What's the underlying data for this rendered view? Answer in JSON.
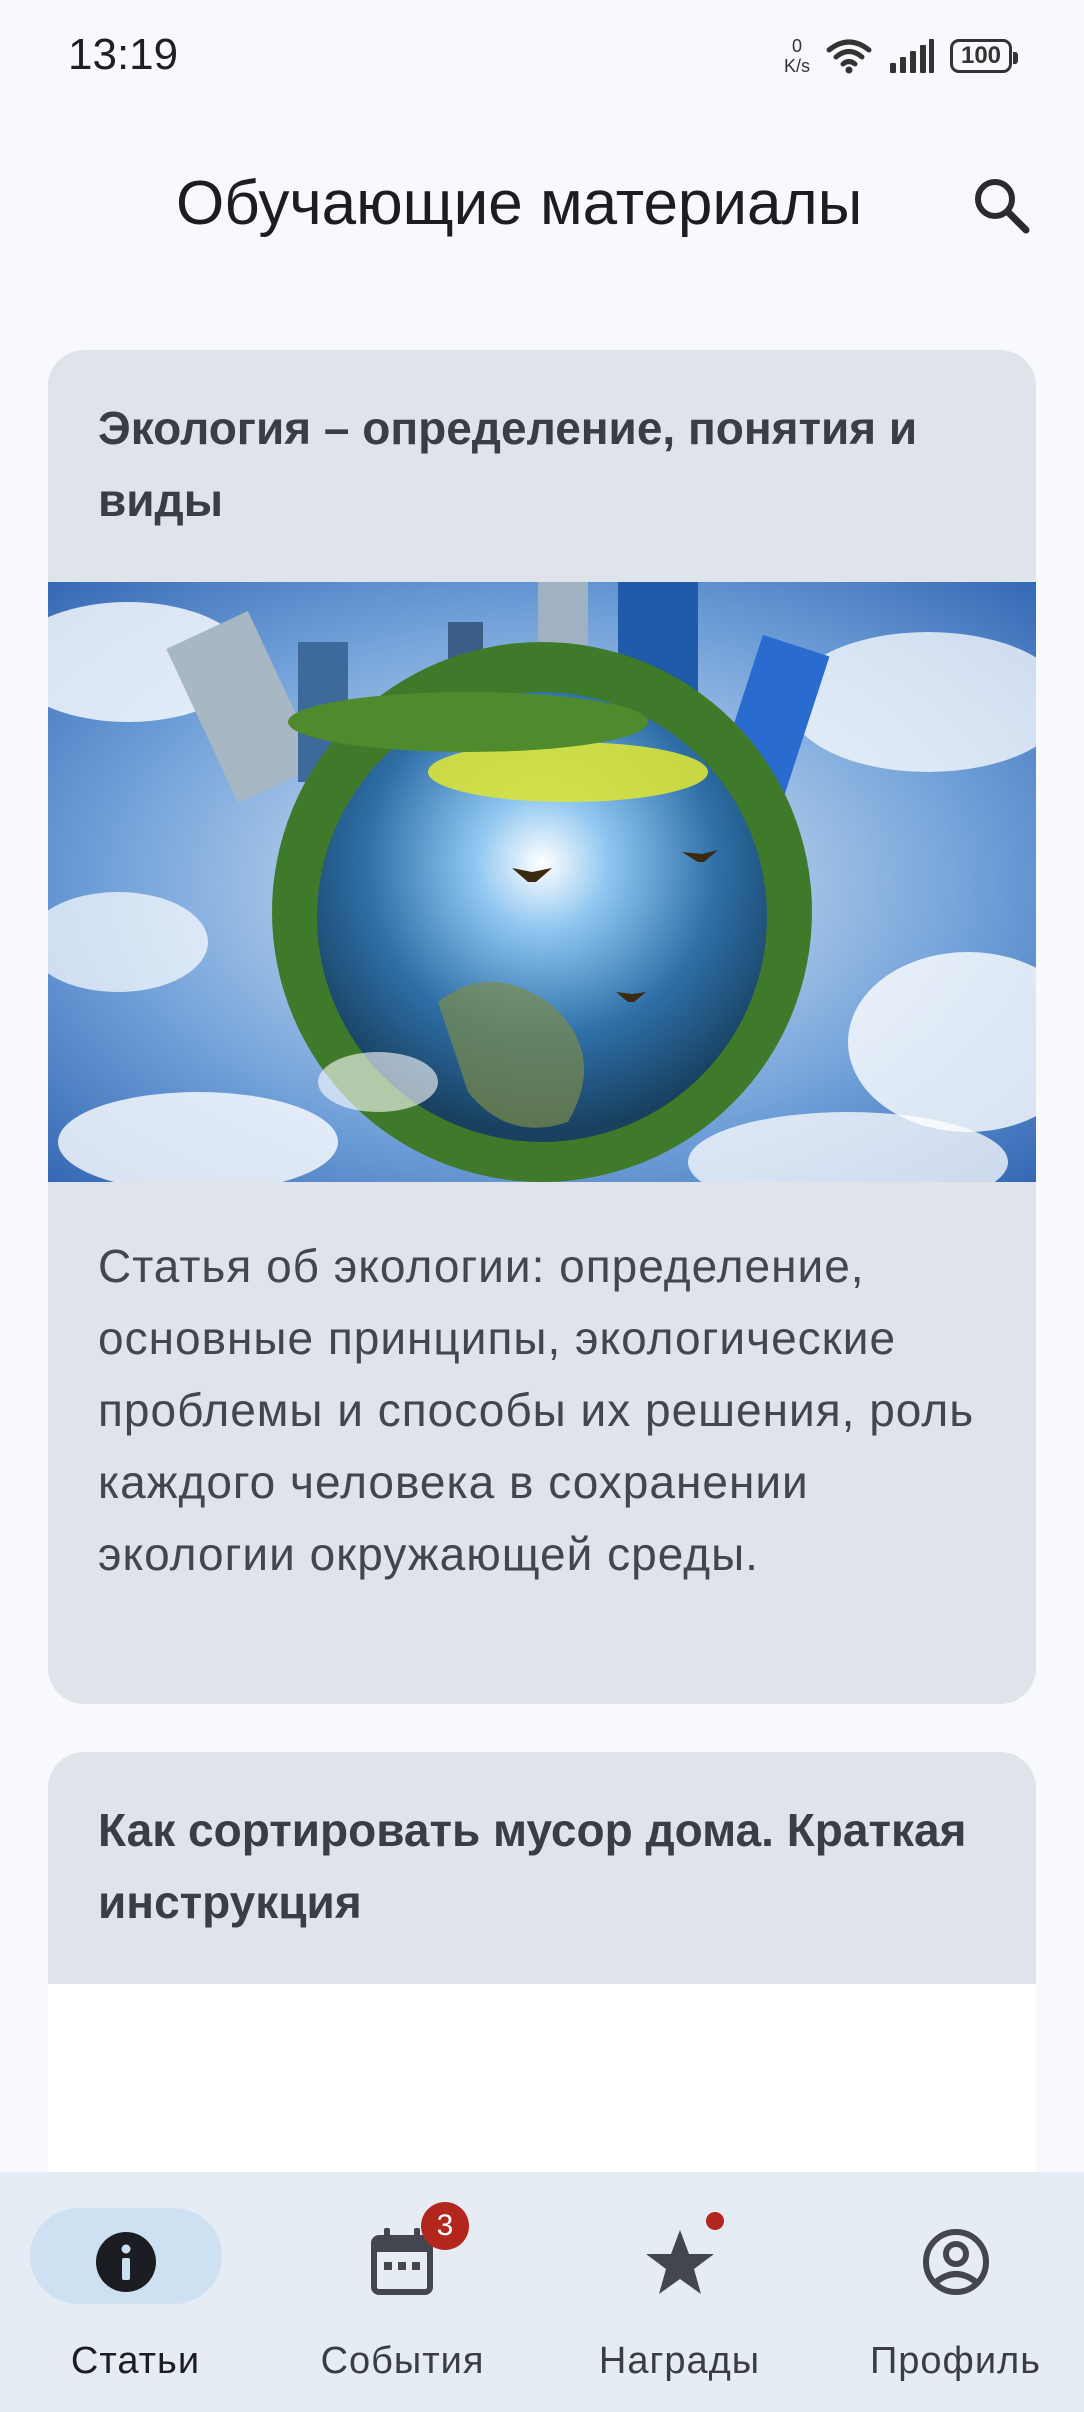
{
  "status_bar": {
    "time": "13:19",
    "net_speed_value": "0",
    "net_speed_unit": "K/s",
    "battery": "100",
    "icons": [
      "wifi-icon",
      "signal-icon",
      "battery-icon"
    ]
  },
  "header": {
    "title": "Обучающие материалы",
    "search_icon": "search-icon"
  },
  "articles": [
    {
      "title": "Экология – определение, понятия и виды",
      "image": "earth-eco-image",
      "description": "Статья об экологии: определение, основные принципы, экологические проблемы и способы их решения, роль каждого человека в сохранении экологии окружающей среды."
    },
    {
      "title": "Как сортировать мусор дома. Краткая инструкция"
    }
  ],
  "bottom_nav": {
    "items": [
      {
        "label": "Статьи",
        "icon": "info-icon",
        "active": true
      },
      {
        "label": "События",
        "icon": "calendar-icon",
        "badge": "3"
      },
      {
        "label": "Награды",
        "icon": "star-icon",
        "dot": true
      },
      {
        "label": "Профиль",
        "icon": "profile-icon"
      }
    ]
  },
  "colors": {
    "background": "#f8f9fc",
    "card": "#dfe3ea",
    "nav_background": "#e5ecf4",
    "active_pill": "#cde1f3",
    "badge": "#b3261e"
  }
}
